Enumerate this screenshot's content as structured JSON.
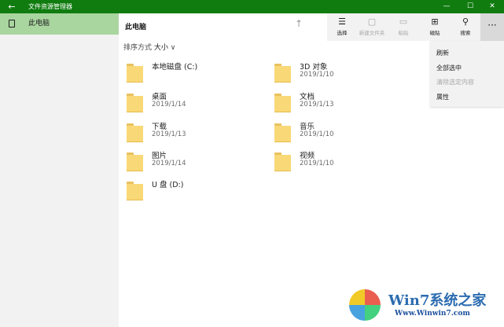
{
  "window": {
    "title": "文件资源管理器",
    "back_glyph": "←",
    "min_glyph": "—",
    "max_glyph": "☐",
    "close_glyph": "✕"
  },
  "sidebar": {
    "items": [
      {
        "label": "此电脑",
        "icon": "tablet-icon",
        "selected": true
      }
    ]
  },
  "header": {
    "title": "此电脑",
    "up_glyph": "↑"
  },
  "commands": {
    "select": {
      "label": "选择",
      "glyph": "☰"
    },
    "new_folder": {
      "label": "新建文件夹",
      "glyph": "▢"
    },
    "paste": {
      "label": "粘贴",
      "glyph": "▭"
    },
    "tiles": {
      "label": "磁贴",
      "glyph": "⊞"
    },
    "search": {
      "label": "搜索",
      "glyph": "⚲"
    },
    "more_glyph": "···"
  },
  "menu": {
    "refresh": "刷新",
    "select_all": "全部选中",
    "clear_selection": "清除选定内容",
    "properties": "属性"
  },
  "sort": {
    "label": "排序方式",
    "value": "大小",
    "chevron": "∨"
  },
  "items": [
    {
      "name": "本地磁盘 (C:)",
      "date": ""
    },
    {
      "name": "3D 对象",
      "date": "2019/1/10"
    },
    {
      "name": "桌面",
      "date": "2019/1/14"
    },
    {
      "name": "文档",
      "date": "2019/1/13"
    },
    {
      "name": "下载",
      "date": "2019/1/13"
    },
    {
      "name": "音乐",
      "date": "2019/1/10"
    },
    {
      "name": "图片",
      "date": "2019/1/14"
    },
    {
      "name": "视频",
      "date": "2019/1/10"
    },
    {
      "name": "U 盘 (D:)",
      "date": ""
    }
  ],
  "watermark": {
    "brand": "Win7系统之家",
    "url": "Www.Winwin7.com"
  },
  "colors": {
    "accent": "#107c10",
    "selection": "#a9d59f",
    "folder": "#f9d877"
  }
}
